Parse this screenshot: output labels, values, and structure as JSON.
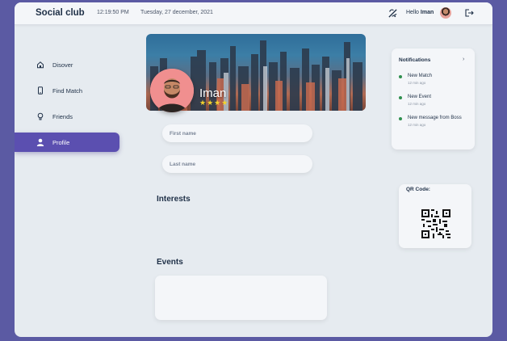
{
  "header": {
    "app_title": "Social club",
    "time": "12:19:50 PM",
    "date": "Tuesday, 27 december, 2021",
    "greeting_prefix": "Hello",
    "greeting_name": "Iman"
  },
  "sidebar": {
    "items": [
      {
        "label": "Disover",
        "icon": "home-icon"
      },
      {
        "label": "Find Match",
        "icon": "phone-icon"
      },
      {
        "label": "Friends",
        "icon": "lightbulb-icon"
      },
      {
        "label": "Profile",
        "icon": "user-icon",
        "active": true
      }
    ]
  },
  "profile": {
    "name": "Iman",
    "rating_stars": 4,
    "stars_text": "★★★★"
  },
  "form": {
    "first_name_placeholder": "First name",
    "last_name_placeholder": "Last name"
  },
  "sections": {
    "interests": "Interests",
    "events": "Events"
  },
  "notifications": {
    "title": "Notifications",
    "items": [
      {
        "title": "New Match",
        "time": "12 min ago"
      },
      {
        "title": "New Event",
        "time": "12 min ago"
      },
      {
        "title": "New message from Boss",
        "time": "12 min ago"
      }
    ]
  },
  "qr": {
    "title": "QR Code:"
  },
  "colors": {
    "background": "#5b5aa3",
    "accent": "#5b4fb0",
    "panel": "#e6ebf0",
    "star": "#f2d22e",
    "status_dot": "#2f8f4e"
  }
}
